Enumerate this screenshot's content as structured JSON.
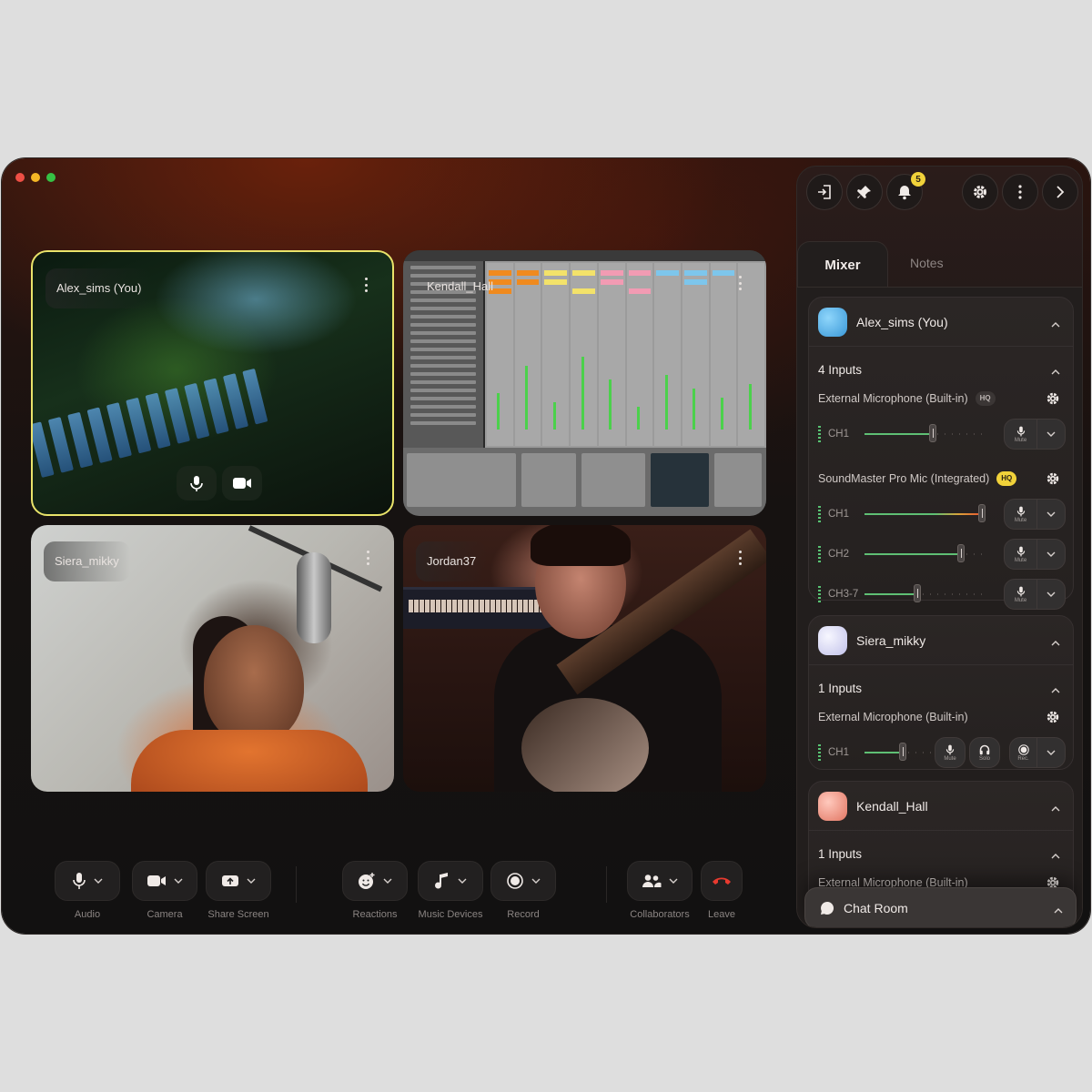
{
  "window": {
    "traffic_lights": [
      "close",
      "minimize",
      "zoom"
    ]
  },
  "tiles": [
    {
      "id": "alex",
      "name": "Alex_sims (You)",
      "active_speaker": true,
      "accent": "#e9e36a"
    },
    {
      "id": "kendall",
      "name": "Kendall_Hall",
      "content": "screen-share-daw"
    },
    {
      "id": "siera",
      "name": "Siera_mikky"
    },
    {
      "id": "jordan",
      "name": "Jordan37"
    }
  ],
  "toolbar": {
    "audio": "Audio",
    "camera": "Camera",
    "share_screen": "Share Screen",
    "reactions": "Reactions",
    "music_devices": "Music Devices",
    "record": "Record",
    "collaborators": "Collaborators",
    "leave": "Leave"
  },
  "panel": {
    "notifications_count": "5",
    "tabs": {
      "mixer": "Mixer",
      "notes": "Notes",
      "active": "Mixer"
    },
    "participants": [
      {
        "name": "Alex_sims (You)",
        "avatar_color": "#5bb6ec",
        "inputs_label": "4 Inputs",
        "devices": [
          {
            "name": "External Microphone (Built-in)",
            "badge": "HQ",
            "badge_style": "grey",
            "channels": [
              {
                "label": "CH1",
                "level": 0.55,
                "button": "Mute"
              }
            ]
          },
          {
            "name": "SoundMaster Pro Mic (Integrated)",
            "badge": "HQ",
            "badge_style": "yellow",
            "channels": [
              {
                "label": "CH1",
                "level": 0.95,
                "button": "Mute"
              },
              {
                "label": "CH2",
                "level": 0.78,
                "button": "Mute"
              },
              {
                "label": "CH3-7",
                "level": 0.43,
                "button": "Mute"
              }
            ]
          }
        ]
      },
      {
        "name": "Siera_mikky",
        "avatar_color": "#dcdcf5",
        "inputs_label": "1 Inputs",
        "devices": [
          {
            "name": "External Microphone (Built-in)",
            "channels": [
              {
                "label": "CH1",
                "level": 0.5,
                "buttons": [
                  "Mute",
                  "Solo",
                  "Rec."
                ]
              }
            ]
          }
        ]
      },
      {
        "name": "Kendall_Hall",
        "avatar_color": "#f09a88",
        "inputs_label": "1 Inputs",
        "devices": [
          {
            "name": "External Microphone (Built-in)"
          }
        ]
      }
    ],
    "chat_room": "Chat Room"
  },
  "colors": {
    "accent_green": "#5fbf74",
    "hq_yellow": "#f1d23a",
    "leave_red": "#e83a2f"
  }
}
